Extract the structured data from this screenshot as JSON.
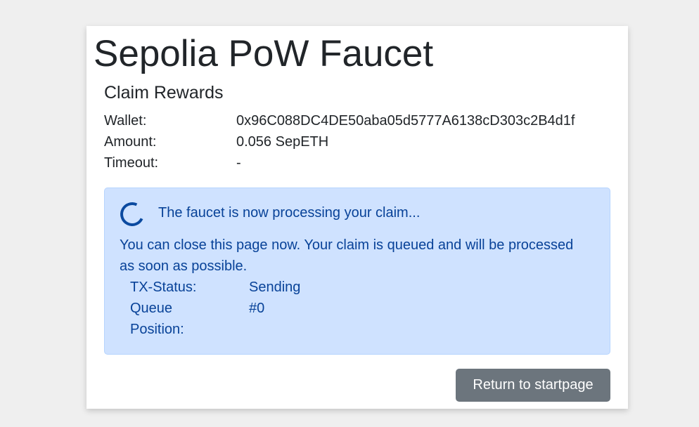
{
  "header": {
    "title": "Sepolia PoW Faucet"
  },
  "claim": {
    "section_title": "Claim Rewards",
    "fields": [
      {
        "label": "Wallet:",
        "value": "0x96C088DC4DE50aba05d5777A6138cD303c2B4d1f"
      },
      {
        "label": "Amount:",
        "value": "0.056 SepETH"
      },
      {
        "label": "Timeout:",
        "value": "-"
      }
    ]
  },
  "status_alert": {
    "spinner_icon": "loading-spinner-icon",
    "heading": "The faucet is now processing your claim...",
    "message": "You can close this page now. Your claim is queued and will be processed as soon as possible.",
    "rows": [
      {
        "label": "TX-Status:",
        "value": "Sending"
      },
      {
        "label": "Queue Position:",
        "value": "#0"
      }
    ],
    "colors": {
      "background": "#cfe2ff",
      "border": "#b6d4fe",
      "text": "#084298"
    }
  },
  "actions": {
    "return_label": "Return to startpage",
    "button_color": "#6c757d"
  }
}
